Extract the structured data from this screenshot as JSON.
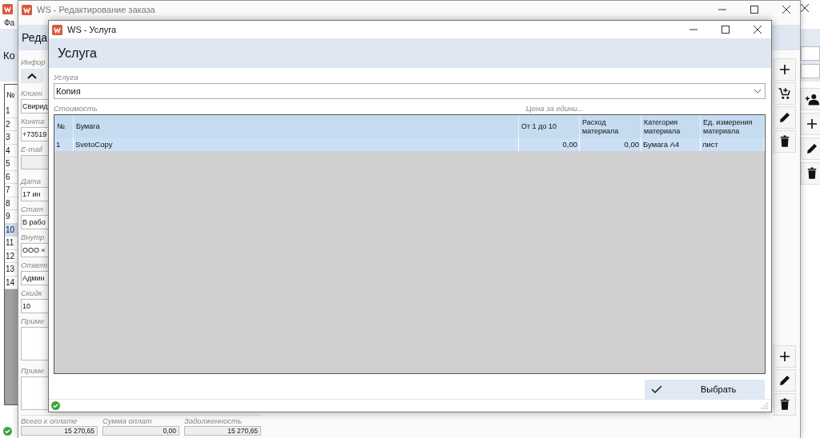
{
  "back_window": {
    "menu": [
      "Фа"
    ],
    "header": "Ко",
    "table": {
      "column": "№",
      "rows": [
        {
          "cells": [
            "1"
          ],
          "selected": false
        },
        {
          "cells": [
            "2"
          ],
          "selected": false
        },
        {
          "cells": [
            "3"
          ],
          "selected": false
        },
        {
          "cells": [
            "4"
          ],
          "selected": false
        },
        {
          "cells": [
            "5"
          ],
          "selected": false
        },
        {
          "cells": [
            "6"
          ],
          "selected": false
        },
        {
          "cells": [
            "7"
          ],
          "selected": false
        },
        {
          "cells": [
            "8"
          ],
          "selected": false
        },
        {
          "cells": [
            "9"
          ],
          "selected": false
        },
        {
          "cells": [
            "10"
          ],
          "selected": true
        },
        {
          "cells": [
            "11"
          ],
          "selected": false
        },
        {
          "cells": [
            "12"
          ],
          "selected": false
        },
        {
          "cells": [
            "13"
          ],
          "selected": false
        },
        {
          "cells": [
            "14"
          ],
          "selected": false
        }
      ]
    }
  },
  "order_window": {
    "title": "WS - Редактирование заказа",
    "header": "Реда",
    "section_label": "Инфор",
    "fields": [
      {
        "label": "Клиен",
        "value": "Свирид",
        "kind": "field"
      },
      {
        "label": "Конта",
        "value": "+73519",
        "kind": "field"
      },
      {
        "label": "E-mail",
        "kind": "field"
      },
      {
        "label": "Дата",
        "value": "17 ин",
        "kind": "field"
      },
      {
        "label": "Стат",
        "value": "В рабо",
        "kind": "field"
      },
      {
        "label": "Внутр",
        "value": "ООО «",
        "kind": "field"
      },
      {
        "label": "Ответ",
        "value": "Админ",
        "kind": "field"
      },
      {
        "label": "Скидк",
        "value": "10",
        "kind": "field"
      },
      {
        "label": "Приме",
        "kind": "textarea"
      },
      {
        "label": "Приме",
        "kind": "textarea"
      }
    ],
    "totals": [
      {
        "label": "Всего к оплате",
        "value": "15 270,65"
      },
      {
        "label": "Сумма оплат",
        "value": "0,00"
      },
      {
        "label": "Задолженность",
        "value": "15 270,65"
      }
    ]
  },
  "service_window": {
    "title": "WS - Услуга",
    "header": "Услуга",
    "service": {
      "label": "Услуга",
      "value": "Копия"
    },
    "cost_label": "Стоимость",
    "price_label": "Цена за едини...",
    "table": {
      "columns": [
        "№",
        "Бумага",
        "От 1 до 10",
        "Расход материала",
        "Категория материала",
        "Ед. измерения материала"
      ],
      "rows": [
        {
          "cells": [
            "1",
            "SvetoCopy",
            "0,00",
            "0,00",
            "Бумага А4",
            "лист"
          ],
          "selected": true
        }
      ]
    },
    "select_button": "Выбрать"
  }
}
